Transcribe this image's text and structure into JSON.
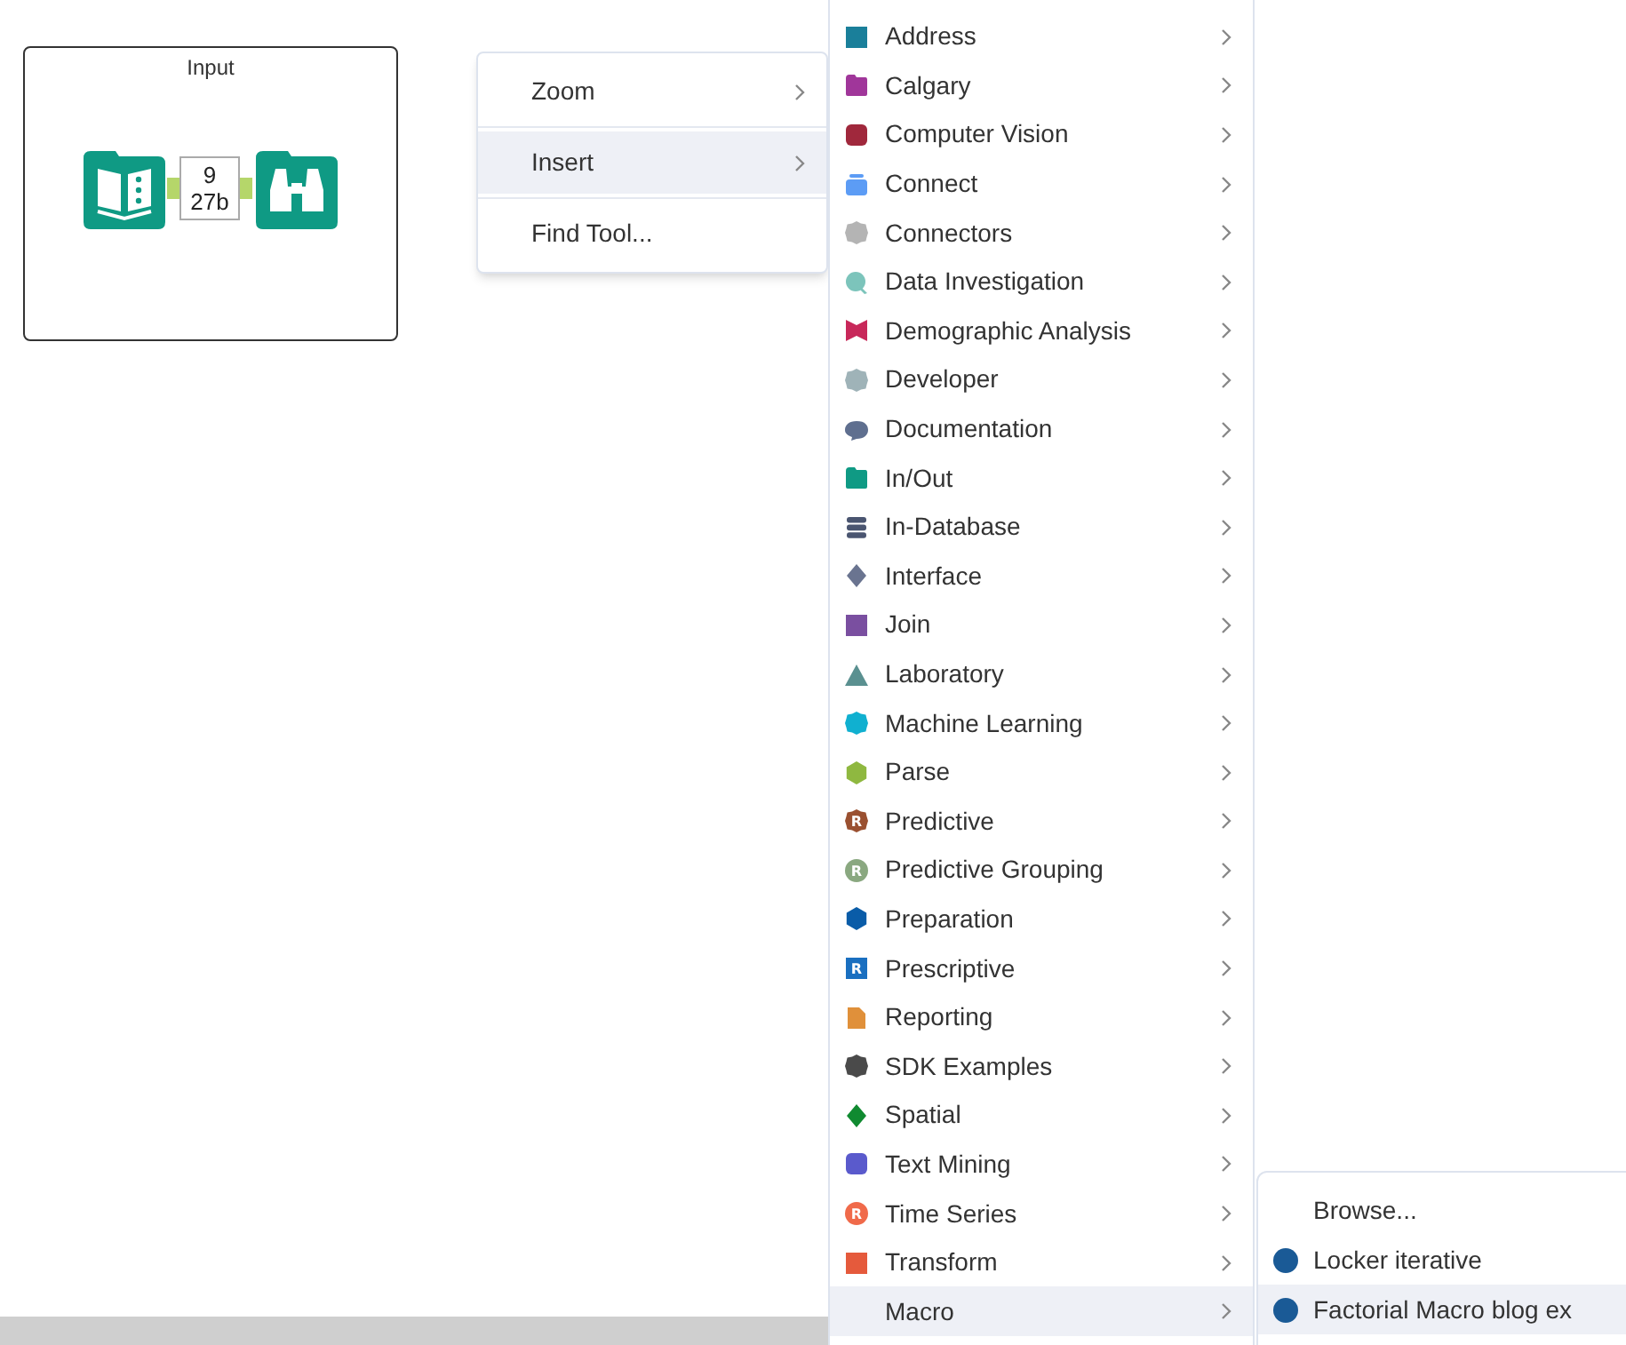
{
  "container": {
    "title": "Input",
    "connection": {
      "records": "9",
      "size": "27b"
    }
  },
  "context_menu": {
    "items": [
      {
        "label": "Zoom",
        "selected": false
      },
      {
        "label": "Insert",
        "selected": true
      },
      {
        "label": "Find Tool...",
        "selected": false
      }
    ]
  },
  "insert_menu": {
    "items": [
      {
        "label": "Address",
        "kind": "square",
        "color": "#1a7f9a",
        "selected": false
      },
      {
        "label": "Calgary",
        "kind": "folder",
        "color": "#a0369a",
        "selected": false
      },
      {
        "label": "Computer Vision",
        "kind": "rounded",
        "color": "#a0283c",
        "selected": false
      },
      {
        "label": "Connect",
        "kind": "tray",
        "color": "#5c9cf5",
        "selected": false
      },
      {
        "label": "Connectors",
        "kind": "gear",
        "color": "#b4b4b4",
        "selected": false
      },
      {
        "label": "Data Investigation",
        "kind": "magnifier",
        "color": "#7cc4bb",
        "selected": false
      },
      {
        "label": "Demographic Analysis",
        "kind": "bowtie",
        "color": "#c8285a",
        "selected": false
      },
      {
        "label": "Developer",
        "kind": "gear",
        "color": "#9fb3b8",
        "selected": false
      },
      {
        "label": "Documentation",
        "kind": "bubble",
        "color": "#5f6f8f",
        "selected": false
      },
      {
        "label": "In/Out",
        "kind": "folder",
        "color": "#0f9a84",
        "selected": false
      },
      {
        "label": "In-Database",
        "kind": "database",
        "color": "#4a5570",
        "selected": false
      },
      {
        "label": "Interface",
        "kind": "diamond",
        "color": "#6a7490",
        "selected": false
      },
      {
        "label": "Join",
        "kind": "square",
        "color": "#7a4fa0",
        "selected": false
      },
      {
        "label": "Laboratory",
        "kind": "triangle",
        "color": "#5a9090",
        "selected": false
      },
      {
        "label": "Machine Learning",
        "kind": "gear",
        "color": "#10b0d0",
        "selected": false
      },
      {
        "label": "Parse",
        "kind": "hexagon",
        "color": "#8fb840",
        "selected": false
      },
      {
        "label": "Predictive",
        "kind": "gear",
        "color": "#9a5030",
        "badge": "R",
        "selected": false
      },
      {
        "label": "Predictive Grouping",
        "kind": "circle",
        "color": "#8aa880",
        "badge": "R",
        "selected": false
      },
      {
        "label": "Preparation",
        "kind": "hexagon",
        "color": "#0a5ca8",
        "selected": false
      },
      {
        "label": "Prescriptive",
        "kind": "square",
        "color": "#1a6fc0",
        "badge": "R",
        "selected": false
      },
      {
        "label": "Reporting",
        "kind": "page",
        "color": "#e0903a",
        "selected": false
      },
      {
        "label": "SDK Examples",
        "kind": "gear",
        "color": "#4a4a4a",
        "selected": false
      },
      {
        "label": "Spatial",
        "kind": "diamond",
        "color": "#108a30",
        "selected": false
      },
      {
        "label": "Text Mining",
        "kind": "rounded",
        "color": "#5a5acc",
        "selected": false
      },
      {
        "label": "Time Series",
        "kind": "circle",
        "color": "#f06a4a",
        "badge": "R",
        "selected": false
      },
      {
        "label": "Transform",
        "kind": "square",
        "color": "#e55a3c",
        "selected": false
      },
      {
        "label": "Macro",
        "kind": "none",
        "selected": true
      }
    ]
  },
  "macro_menu": {
    "items": [
      {
        "label": "Browse...",
        "kind": "none",
        "selected": false
      },
      {
        "label": "Locker iterative",
        "kind": "macro",
        "selected": false
      },
      {
        "label": "Factorial Macro blog ex",
        "kind": "macro",
        "selected": true
      }
    ]
  }
}
